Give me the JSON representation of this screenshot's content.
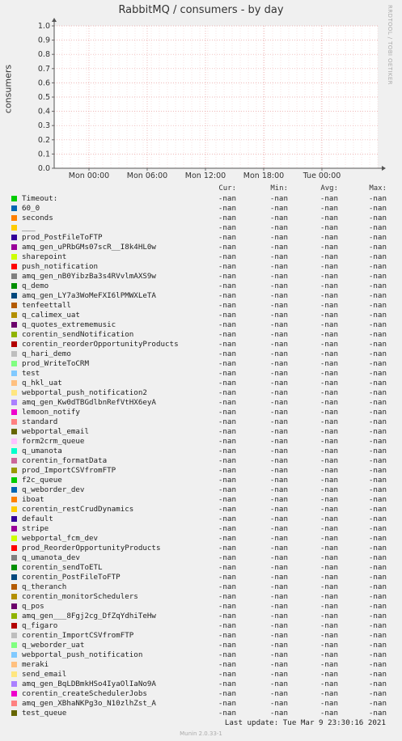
{
  "header": {
    "title": "RabbitMQ / consumers - by day",
    "side_label": "RRDTOOL / TOBI OETIKER",
    "ylabel": "consumers"
  },
  "chart_data": {
    "type": "line",
    "title": "RabbitMQ / consumers - by day",
    "ylabel": "consumers",
    "xlabel": "",
    "ylim": [
      0,
      1.0
    ],
    "y_ticks": [
      "0.0",
      "0.1",
      "0.2",
      "0.3",
      "0.4",
      "0.5",
      "0.6",
      "0.7",
      "0.8",
      "0.9",
      "1.0"
    ],
    "x_ticks": [
      "Mon 00:00",
      "Mon 06:00",
      "Mon 12:00",
      "Mon 18:00",
      "Tue 00:00"
    ],
    "grid": true,
    "series_values": "no data (all -nan)"
  },
  "legend": {
    "headers": {
      "cur": "Cur:",
      "min": "Min:",
      "avg": "Avg:",
      "max": "Max:"
    },
    "rows": [
      {
        "name": "Timeout:",
        "color": "#00cc00",
        "cur": "-nan",
        "min": "-nan",
        "avg": "-nan",
        "max": "-nan"
      },
      {
        "name": "60_0",
        "color": "#0066b3",
        "cur": "-nan",
        "min": "-nan",
        "avg": "-nan",
        "max": "-nan"
      },
      {
        "name": "seconds",
        "color": "#ff8000",
        "cur": "-nan",
        "min": "-nan",
        "avg": "-nan",
        "max": "-nan"
      },
      {
        "name": "___",
        "color": "#ffcc00",
        "cur": "-nan",
        "min": "-nan",
        "avg": "-nan",
        "max": "-nan"
      },
      {
        "name": "prod_PostFileToFTP",
        "color": "#330099",
        "cur": "-nan",
        "min": "-nan",
        "avg": "-nan",
        "max": "-nan"
      },
      {
        "name": "amq_gen_uPRbGMs07scR__I8k4HL0w",
        "color": "#990099",
        "cur": "-nan",
        "min": "-nan",
        "avg": "-nan",
        "max": "-nan"
      },
      {
        "name": "sharepoint",
        "color": "#ccff00",
        "cur": "-nan",
        "min": "-nan",
        "avg": "-nan",
        "max": "-nan"
      },
      {
        "name": "push_notification",
        "color": "#ff0000",
        "cur": "-nan",
        "min": "-nan",
        "avg": "-nan",
        "max": "-nan"
      },
      {
        "name": "amq_gen_nB0YibzBa3s4RVvlmAXS9w",
        "color": "#808080",
        "cur": "-nan",
        "min": "-nan",
        "avg": "-nan",
        "max": "-nan"
      },
      {
        "name": "q_demo",
        "color": "#008f00",
        "cur": "-nan",
        "min": "-nan",
        "avg": "-nan",
        "max": "-nan"
      },
      {
        "name": "amq_gen_LY7a3WoMeFXI6lPMWXLeTA",
        "color": "#00487d",
        "cur": "-nan",
        "min": "-nan",
        "avg": "-nan",
        "max": "-nan"
      },
      {
        "name": "tenfeettall",
        "color": "#b35a00",
        "cur": "-nan",
        "min": "-nan",
        "avg": "-nan",
        "max": "-nan"
      },
      {
        "name": "q_calimex_uat",
        "color": "#b38f00",
        "cur": "-nan",
        "min": "-nan",
        "avg": "-nan",
        "max": "-nan"
      },
      {
        "name": "q_quotes_extrememusic",
        "color": "#6b006b",
        "cur": "-nan",
        "min": "-nan",
        "avg": "-nan",
        "max": "-nan"
      },
      {
        "name": "corentin_sendNotification",
        "color": "#8fb300",
        "cur": "-nan",
        "min": "-nan",
        "avg": "-nan",
        "max": "-nan"
      },
      {
        "name": "corentin_reorderOpportunityProducts",
        "color": "#b30000",
        "cur": "-nan",
        "min": "-nan",
        "avg": "-nan",
        "max": "-nan"
      },
      {
        "name": "q_hari_demo",
        "color": "#bebebe",
        "cur": "-nan",
        "min": "-nan",
        "avg": "-nan",
        "max": "-nan"
      },
      {
        "name": "prod_WriteToCRM",
        "color": "#80ff80",
        "cur": "-nan",
        "min": "-nan",
        "avg": "-nan",
        "max": "-nan"
      },
      {
        "name": "test",
        "color": "#80c9ff",
        "cur": "-nan",
        "min": "-nan",
        "avg": "-nan",
        "max": "-nan"
      },
      {
        "name": "q_hkl_uat",
        "color": "#ffc080",
        "cur": "-nan",
        "min": "-nan",
        "avg": "-nan",
        "max": "-nan"
      },
      {
        "name": "webportal_push_notification2",
        "color": "#ffe680",
        "cur": "-nan",
        "min": "-nan",
        "avg": "-nan",
        "max": "-nan"
      },
      {
        "name": "amq_gen_Kw0dTBGdlbnRefVtHX6eyA",
        "color": "#aa80ff",
        "cur": "-nan",
        "min": "-nan",
        "avg": "-nan",
        "max": "-nan"
      },
      {
        "name": "lemoon_notify",
        "color": "#ee00cc",
        "cur": "-nan",
        "min": "-nan",
        "avg": "-nan",
        "max": "-nan"
      },
      {
        "name": "standard",
        "color": "#ff8080",
        "cur": "-nan",
        "min": "-nan",
        "avg": "-nan",
        "max": "-nan"
      },
      {
        "name": "webportal_email",
        "color": "#666600",
        "cur": "-nan",
        "min": "-nan",
        "avg": "-nan",
        "max": "-nan"
      },
      {
        "name": "form2crm_queue",
        "color": "#ffbfff",
        "cur": "-nan",
        "min": "-nan",
        "avg": "-nan",
        "max": "-nan"
      },
      {
        "name": "q_umanota",
        "color": "#00ffcc",
        "cur": "-nan",
        "min": "-nan",
        "avg": "-nan",
        "max": "-nan"
      },
      {
        "name": "corentin_formatData",
        "color": "#cc6699",
        "cur": "-nan",
        "min": "-nan",
        "avg": "-nan",
        "max": "-nan"
      },
      {
        "name": "prod_ImportCSVfromFTP",
        "color": "#999900",
        "cur": "-nan",
        "min": "-nan",
        "avg": "-nan",
        "max": "-nan"
      },
      {
        "name": "f2c_queue",
        "color": "#00cc00",
        "cur": "-nan",
        "min": "-nan",
        "avg": "-nan",
        "max": "-nan"
      },
      {
        "name": "q_weborder_dev",
        "color": "#0066b3",
        "cur": "-nan",
        "min": "-nan",
        "avg": "-nan",
        "max": "-nan"
      },
      {
        "name": "iboat",
        "color": "#ff8000",
        "cur": "-nan",
        "min": "-nan",
        "avg": "-nan",
        "max": "-nan"
      },
      {
        "name": "corentin_restCrudDynamics",
        "color": "#ffcc00",
        "cur": "-nan",
        "min": "-nan",
        "avg": "-nan",
        "max": "-nan"
      },
      {
        "name": "default",
        "color": "#330099",
        "cur": "-nan",
        "min": "-nan",
        "avg": "-nan",
        "max": "-nan"
      },
      {
        "name": "stripe",
        "color": "#990099",
        "cur": "-nan",
        "min": "-nan",
        "avg": "-nan",
        "max": "-nan"
      },
      {
        "name": "webportal_fcm_dev",
        "color": "#ccff00",
        "cur": "-nan",
        "min": "-nan",
        "avg": "-nan",
        "max": "-nan"
      },
      {
        "name": "prod_ReorderOpportunityProducts",
        "color": "#ff0000",
        "cur": "-nan",
        "min": "-nan",
        "avg": "-nan",
        "max": "-nan"
      },
      {
        "name": "q_umanota_dev",
        "color": "#808080",
        "cur": "-nan",
        "min": "-nan",
        "avg": "-nan",
        "max": "-nan"
      },
      {
        "name": "corentin_sendToETL",
        "color": "#008f00",
        "cur": "-nan",
        "min": "-nan",
        "avg": "-nan",
        "max": "-nan"
      },
      {
        "name": "corentin_PostFileToFTP",
        "color": "#00487d",
        "cur": "-nan",
        "min": "-nan",
        "avg": "-nan",
        "max": "-nan"
      },
      {
        "name": "q_theranch",
        "color": "#b35a00",
        "cur": "-nan",
        "min": "-nan",
        "avg": "-nan",
        "max": "-nan"
      },
      {
        "name": "corentin_monitorSchedulers",
        "color": "#b38f00",
        "cur": "-nan",
        "min": "-nan",
        "avg": "-nan",
        "max": "-nan"
      },
      {
        "name": "q_pos",
        "color": "#6b006b",
        "cur": "-nan",
        "min": "-nan",
        "avg": "-nan",
        "max": "-nan"
      },
      {
        "name": "amq_gen___8Fgj2cg_DfZqYdhiTeHw",
        "color": "#8fb300",
        "cur": "-nan",
        "min": "-nan",
        "avg": "-nan",
        "max": "-nan"
      },
      {
        "name": "q_figaro",
        "color": "#b30000",
        "cur": "-nan",
        "min": "-nan",
        "avg": "-nan",
        "max": "-nan"
      },
      {
        "name": "corentin_ImportCSVfromFTP",
        "color": "#bebebe",
        "cur": "-nan",
        "min": "-nan",
        "avg": "-nan",
        "max": "-nan"
      },
      {
        "name": "q_weborder_uat",
        "color": "#80ff80",
        "cur": "-nan",
        "min": "-nan",
        "avg": "-nan",
        "max": "-nan"
      },
      {
        "name": "webportal_push_notification",
        "color": "#80c9ff",
        "cur": "-nan",
        "min": "-nan",
        "avg": "-nan",
        "max": "-nan"
      },
      {
        "name": "meraki",
        "color": "#ffc080",
        "cur": "-nan",
        "min": "-nan",
        "avg": "-nan",
        "max": "-nan"
      },
      {
        "name": "send_email",
        "color": "#ffe680",
        "cur": "-nan",
        "min": "-nan",
        "avg": "-nan",
        "max": "-nan"
      },
      {
        "name": "amq_gen_BqLDBmkHSo4IyaOlIaNo9A",
        "color": "#aa80ff",
        "cur": "-nan",
        "min": "-nan",
        "avg": "-nan",
        "max": "-nan"
      },
      {
        "name": "corentin_createSchedulerJobs",
        "color": "#ee00cc",
        "cur": "-nan",
        "min": "-nan",
        "avg": "-nan",
        "max": "-nan"
      },
      {
        "name": "amq_gen_XBhaNKPg3o_N10zlhZst_A",
        "color": "#ff8080",
        "cur": "-nan",
        "min": "-nan",
        "avg": "-nan",
        "max": "-nan"
      },
      {
        "name": "test_queue",
        "color": "#666600",
        "cur": "-nan",
        "min": "-nan",
        "avg": "-nan",
        "max": "-nan"
      }
    ]
  },
  "footer": {
    "last_update": "Last update:  Tue Mar  9 23:30:16 2021",
    "munin_version": "Munin 2.0.33-1"
  }
}
